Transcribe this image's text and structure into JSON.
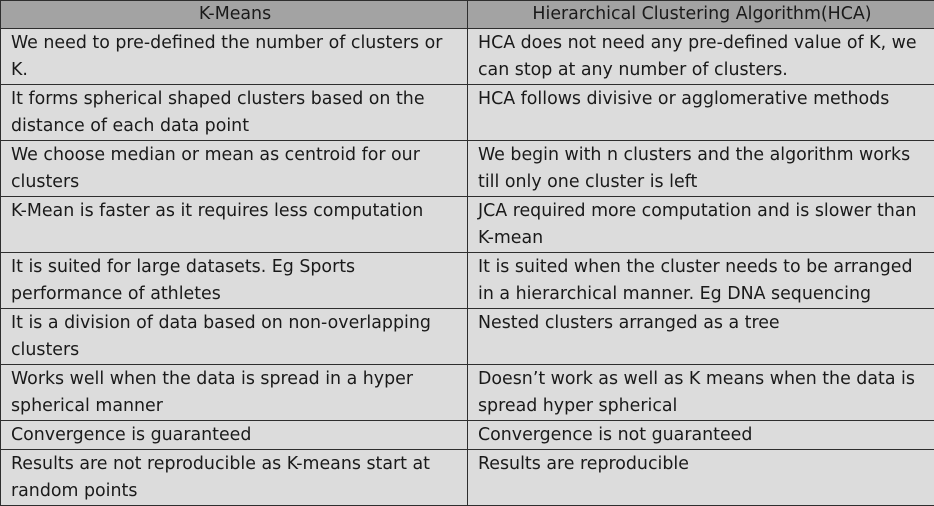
{
  "table": {
    "headers": [
      "K-Means",
      "Hierarchical Clustering Algorithm(HCA)"
    ],
    "rows": [
      [
        "We need to pre-defined the number of clusters or K.",
        "HCA does not need any pre-defined value of K, we can stop at any number of clusters."
      ],
      [
        "It forms spherical shaped clusters based on the distance of each data point",
        "HCA follows divisive or agglomerative methods"
      ],
      [
        "We choose median or mean as centroid for our clusters",
        "We begin with n clusters and the algorithm works till only one cluster is left"
      ],
      [
        "K-Mean is faster as it requires less computation",
        "JCA required more computation and is slower than K-mean"
      ],
      [
        "It is suited for large datasets. Eg Sports performance of athletes",
        "It is suited when the cluster needs to be arranged in a hierarchical manner. Eg DNA sequencing"
      ],
      [
        "It is a division of data based on non-overlapping clusters",
        "Nested clusters arranged as a tree"
      ],
      [
        "Works well when the data is spread in a hyper spherical manner",
        "Doesn’t work as well as K means when the data is spread hyper spherical"
      ],
      [
        "Convergence is guaranteed",
        "Convergence is not guaranteed"
      ],
      [
        "Results are not reproducible as K-means start at random points",
        "Results are reproducible"
      ]
    ]
  }
}
